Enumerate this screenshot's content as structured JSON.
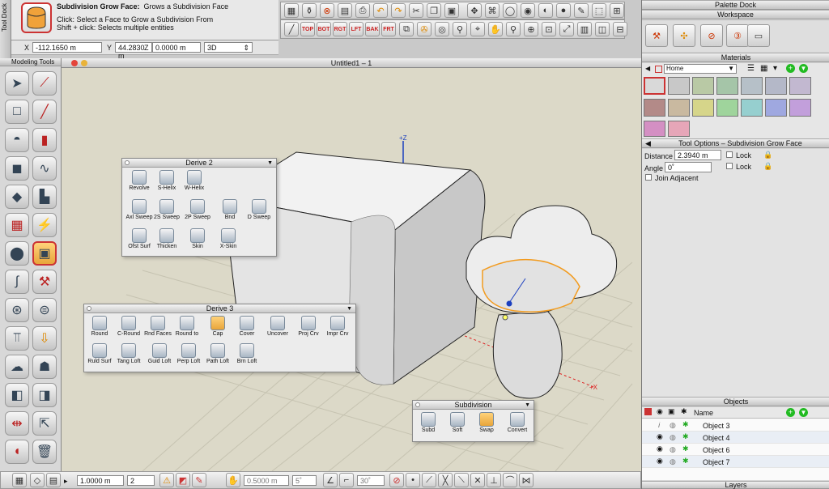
{
  "tooldock": {
    "tab_label": "Tool Dock"
  },
  "tool_info": {
    "title_label": "Subdivision Grow Face:",
    "title_desc": "Grows a Subdivision Face",
    "help_line1": "Click: Select a Face to Grow a Subdivision From",
    "help_line2": "Shift + click: Selects multiple entities"
  },
  "coords": {
    "x_label": "X",
    "x_value": "-112.1650 m",
    "y_label": "Y",
    "y_value": "44.2830 m",
    "z_label": "Z",
    "z_value": "0.0000 m",
    "view_value": "3D"
  },
  "view_buttons": [
    "TOP",
    "BOT",
    "RGT",
    "LFT",
    "BAK",
    "FRT"
  ],
  "modeling_tools": {
    "title": "Modeling Tools"
  },
  "viewport": {
    "title": "Untitled1 – 1",
    "axis_z": "+Z",
    "axis_x": "+X"
  },
  "derive2": {
    "title": "Derive 2",
    "items": [
      "Revolve",
      "S-Helix",
      "W-Helix",
      "Axl Sweep",
      "2S Sweep",
      "2P Sweep",
      "Bnd",
      "D Sweep",
      "Ofst Surf",
      "Thicken",
      "Skin",
      "X-Skin"
    ]
  },
  "derive3": {
    "title": "Derive 3",
    "items": [
      "Round",
      "C-Round",
      "Rnd Faces",
      "Round to",
      "Cap",
      "Cover",
      "Uncover",
      "Proj Crv",
      "Impr Crv",
      "Ruld Surf",
      "Tang Loft",
      "Guid Loft",
      "Perp Loft",
      "Path Loft",
      "Brn Loft"
    ]
  },
  "subdivision": {
    "title": "Subdivision",
    "items": [
      "Subd",
      "Soft",
      "Swap",
      "Convert"
    ]
  },
  "dock": {
    "title": "Palette Dock",
    "workspace": "Workspace",
    "materials": "Materials",
    "materials_select": "Home",
    "tool_options_title": "Tool Options – Subdivision Grow Face",
    "distance_label": "Distance",
    "distance_value": "2.3940 m",
    "angle_label": "Angle",
    "angle_value": "0˚",
    "lock_label": "Lock",
    "join_label": "Join Adjacent",
    "objects_title": "Objects",
    "name_header": "Name",
    "objects": [
      "Object 3",
      "Object 4",
      "Object 6",
      "Object 7"
    ],
    "layers_title": "Layers"
  },
  "bottombar": {
    "length_value": "1.0000 m",
    "count_value": "2",
    "snap_value": "0.5000 m",
    "angle_value": "5˚",
    "angle2_value": "30˚"
  },
  "colors": {
    "grid": "#c9c6b4",
    "viewport": "#dcd9c8",
    "highlight": "#f29b1f",
    "axis": "#1b3fbf"
  }
}
